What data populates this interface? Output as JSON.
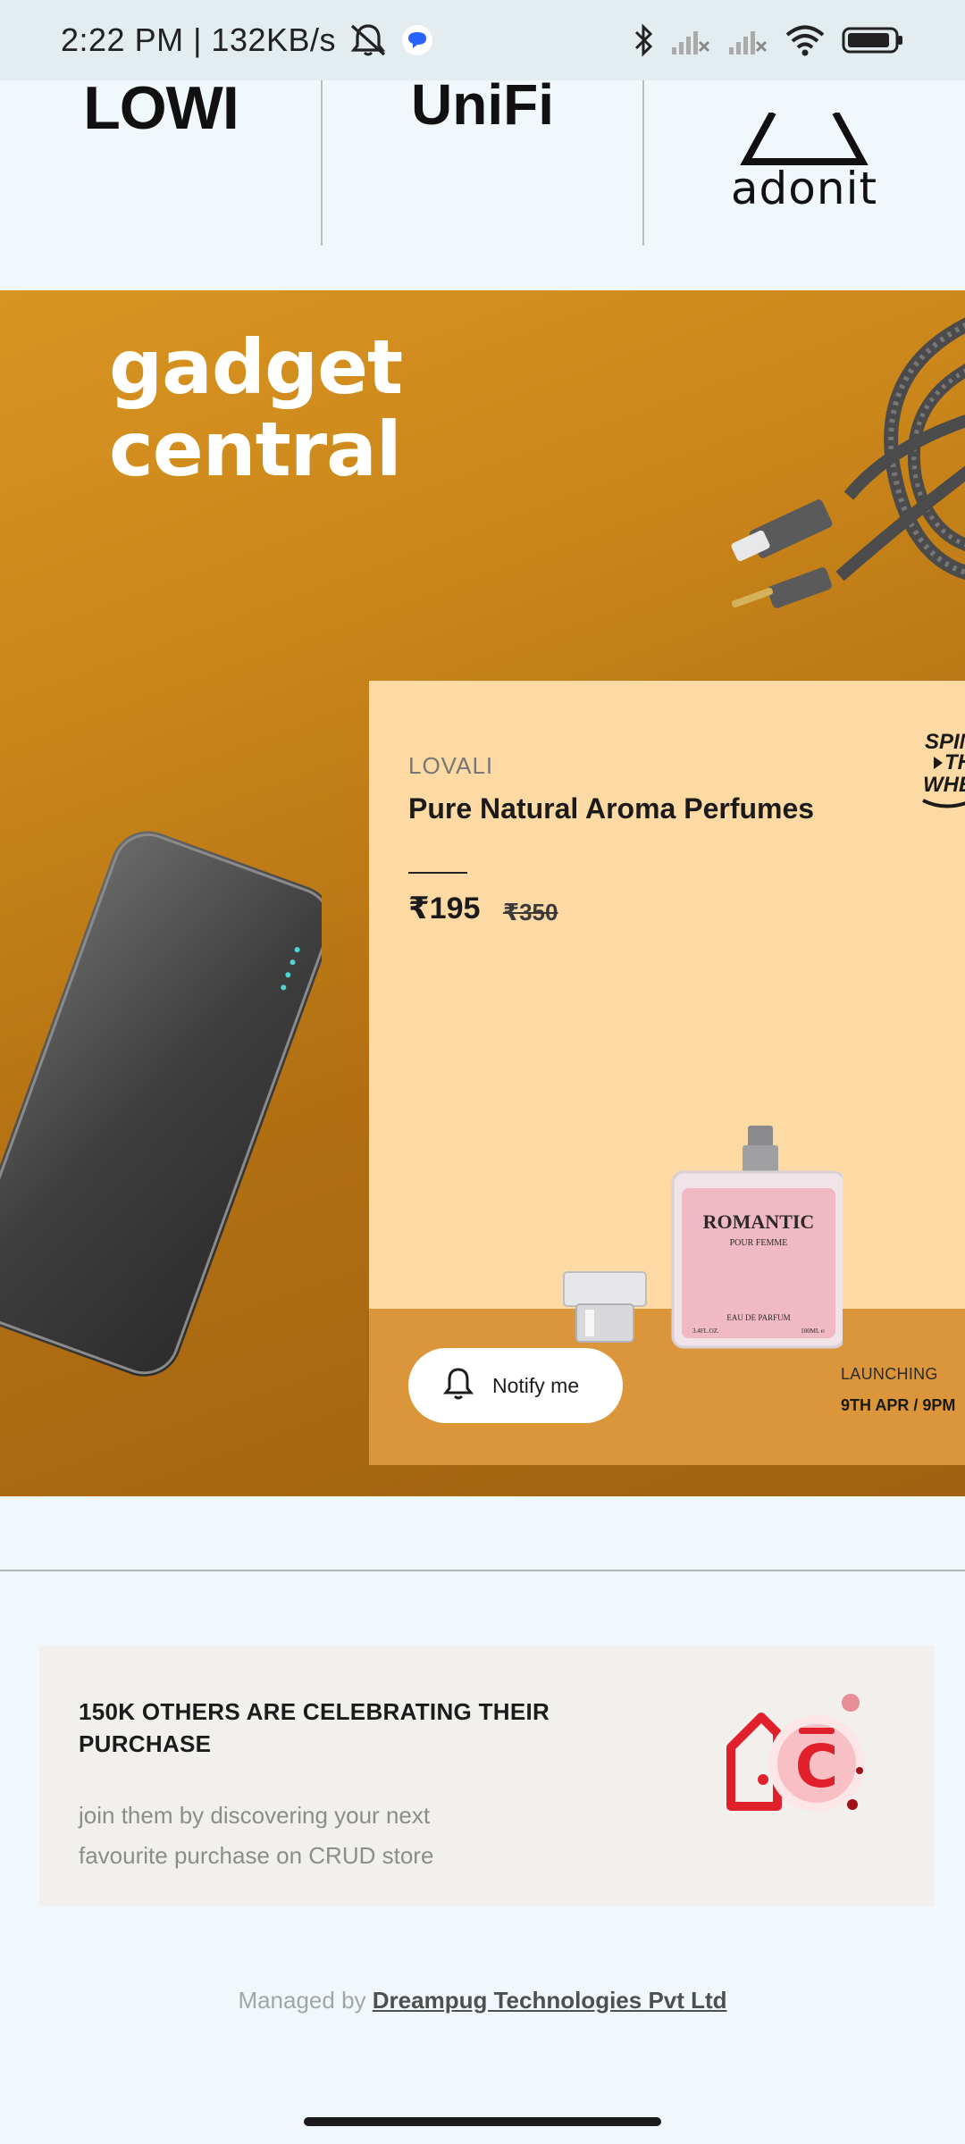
{
  "status_bar": {
    "time": "2:22 PM | 132KB/s",
    "icons": [
      "mute-bell-icon",
      "chat-bubble-icon",
      "bluetooth-icon",
      "signal-1-icon",
      "signal-2-icon",
      "wifi-icon",
      "battery-icon"
    ],
    "chat_color": "#2962ff"
  },
  "brands": [
    {
      "name": "LOWI"
    },
    {
      "name": "UniFi"
    },
    {
      "name": "adonit"
    }
  ],
  "promo": {
    "title_line1": "gadget",
    "title_line2": "central",
    "background_color": "#c9851a",
    "card": {
      "brand": "LOVALI",
      "product_name": "Pure Natural Aroma Perfumes",
      "price": "₹195",
      "mrp": "₹350",
      "spin_badge_lines": [
        "SPIN",
        "THE",
        "WHEEL"
      ],
      "notify_label": "Notify me",
      "launching_label": "LAUNCHING",
      "launch_date": "9TH APR / 9PM",
      "perfume_label": "ROMANTIC",
      "perfume_sub": "POUR FEMME",
      "perfume_bottom": "EAU DE PARFUM",
      "perfume_volume_left": "3.4FL.OZ.",
      "perfume_volume_right": "100ML ℮"
    }
  },
  "celebrate": {
    "title": "150K OTHERS ARE CELEBRATING THEIR PURCHASE",
    "subtitle": "join them by discovering your next favourite purchase on CRUD store",
    "logo_letter": "C",
    "brand_color": "#e0202a"
  },
  "footer": {
    "prefix": "Managed by ",
    "link": "Dreampug Technologies Pvt Ltd"
  }
}
